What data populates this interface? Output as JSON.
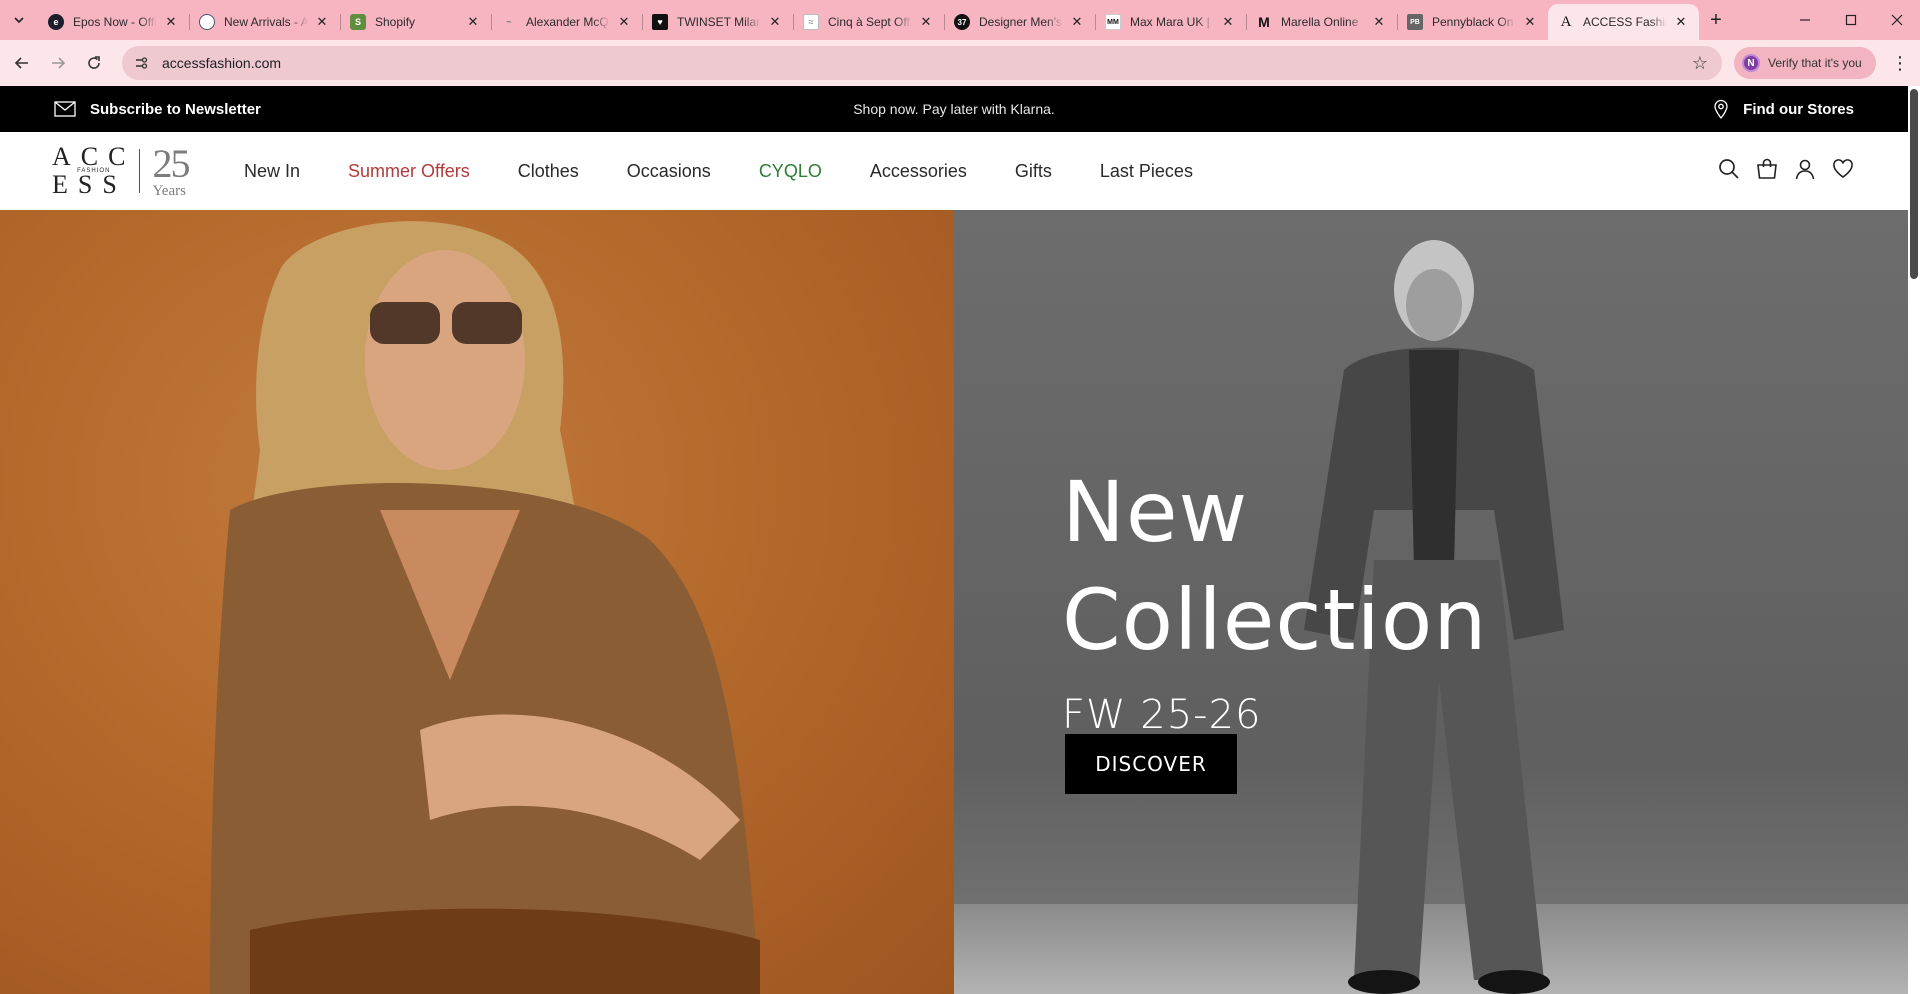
{
  "browser": {
    "tabs": [
      {
        "title": "Epos Now - Offi",
        "favicon_color": "#1d1d2e",
        "favicon_glyph": "e",
        "active": false
      },
      {
        "title": "New Arrivals - A",
        "favicon_color": "#4a5568",
        "favicon_glyph": "◍",
        "active": false
      },
      {
        "title": "Shopify",
        "favicon_color": "#5e8e3e",
        "favicon_glyph": "S",
        "active": false
      },
      {
        "title": "Alexander McQ",
        "favicon_color": "#9b9b9b",
        "favicon_glyph": "~",
        "active": false
      },
      {
        "title": "TWINSET Milano",
        "favicon_color": "#111111",
        "favicon_glyph": "♥",
        "active": false
      },
      {
        "title": "Cinq à Sept Off",
        "favicon_color": "#b8b8b8",
        "favicon_glyph": "≈",
        "active": false
      },
      {
        "title": "Designer Men's",
        "favicon_color": "#111111",
        "favicon_glyph": "37",
        "active": false
      },
      {
        "title": "Max Mara UK |",
        "favicon_color": "#ffffff",
        "favicon_glyph": "MM",
        "active": false
      },
      {
        "title": "Marella Online",
        "favicon_color": "#ffffff",
        "favicon_glyph": "M",
        "active": false
      },
      {
        "title": "Pennyblack On",
        "favicon_color": "#666666",
        "favicon_glyph": "PB",
        "active": false
      },
      {
        "title": "ACCESS Fashion",
        "favicon_color": "#ffffff",
        "favicon_glyph": "A",
        "active": true
      }
    ],
    "close_glyph": "✕",
    "new_tab_glyph": "+",
    "url": "accessfashion.com",
    "verify_label": "Verify that it's you",
    "verify_avatar": "N",
    "chrome_color": "#f7b5c2"
  },
  "promo": {
    "newsletter": "Subscribe to Newsletter",
    "center": "Shop now. Pay later with Klarna.",
    "stores": "Find our Stores"
  },
  "logo": {
    "line1": "ACC",
    "fashion": "FASHION",
    "line2": "ESS",
    "years_num": "25",
    "years_word": "Years"
  },
  "nav": {
    "items": [
      {
        "label": "New In",
        "style": "default"
      },
      {
        "label": "Summer Offers",
        "style": "red"
      },
      {
        "label": "Clothes",
        "style": "default"
      },
      {
        "label": "Occasions",
        "style": "default"
      },
      {
        "label": "CYQLO",
        "style": "green"
      },
      {
        "label": "Accessories",
        "style": "default"
      },
      {
        "label": "Gifts",
        "style": "default"
      },
      {
        "label": "Last Pieces",
        "style": "default"
      }
    ]
  },
  "hero": {
    "title_line1": "New",
    "title_line2": "Collection",
    "subtitle": "FW 25-26",
    "cta": "DISCOVER"
  }
}
